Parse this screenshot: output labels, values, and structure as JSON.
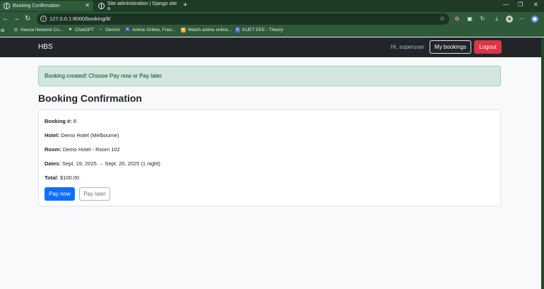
{
  "browser": {
    "tabs": [
      {
        "title": "Booking Confirmation",
        "active": true
      },
      {
        "title": "Site administration | Django site a",
        "active": false
      }
    ],
    "url": "127.0.0.1:8000/booking/8/",
    "bookmarks": [
      {
        "label": "Neural Network Co..."
      },
      {
        "label": "ChatGPT"
      },
      {
        "label": "Gemini"
      },
      {
        "label": "Anime Online, Free..."
      },
      {
        "label": "Watch anime online..."
      },
      {
        "label": "KUET EEE - Theory"
      }
    ]
  },
  "navbar": {
    "brand": "HBS",
    "greeting": "Hi, superuser",
    "bookings_label": "My bookings",
    "logout_label": "Logout"
  },
  "alert": {
    "message": "Booking created! Choose Pay now or Pay later."
  },
  "page": {
    "title": "Booking Confirmation"
  },
  "booking": {
    "number_label": "Booking #:",
    "number": "8",
    "hotel_label": "Hotel:",
    "hotel": "Demo Hotel (Melbourne)",
    "room_label": "Room:",
    "room": "Demo Hotel - Room 102",
    "dates_label": "Dates:",
    "dates": "Sept. 19, 2025 → Sept. 20, 2025 (1 night)",
    "total_label": "Total:",
    "total": "$100.00"
  },
  "actions": {
    "pay_now": "Pay now",
    "pay_later": "Pay later"
  },
  "colors": {
    "primary": "#0d6efd",
    "danger": "#dc3545",
    "navbar_bg": "#212529",
    "alert_bg": "#d1e7dd"
  }
}
